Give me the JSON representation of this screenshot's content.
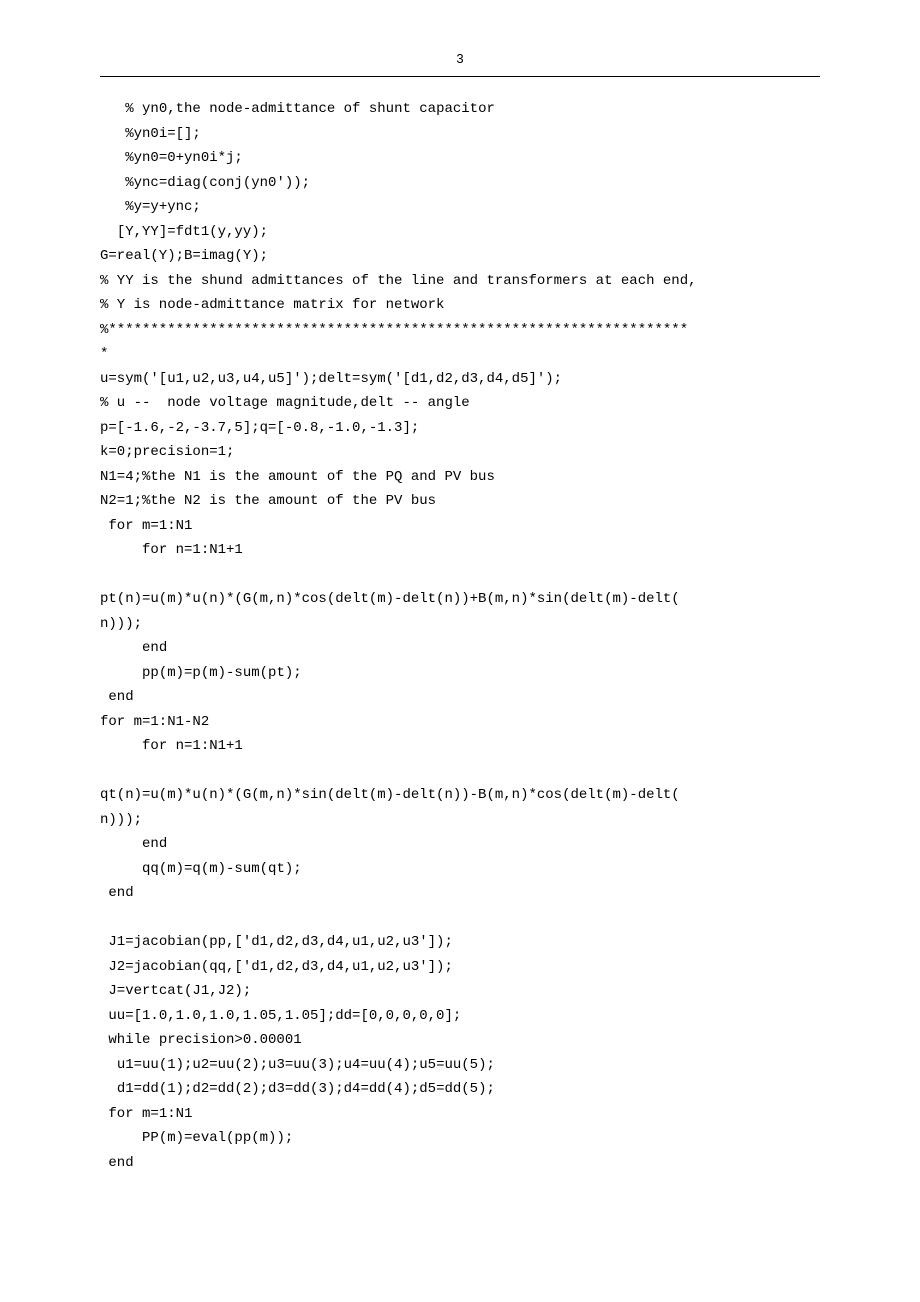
{
  "page_number": "3",
  "code_lines": [
    "   % yn0,the node-admittance of shunt capacitor",
    "   %yn0i=[];",
    "   %yn0=0+yn0i*j;",
    "   %ync=diag(conj(yn0'));",
    "   %y=y+ync;",
    "  [Y,YY]=fdt1(y,yy);",
    "G=real(Y);B=imag(Y);",
    "% YY is the shund admittances of the line and transformers at each end,",
    "% Y is node-admittance matrix for network",
    "%*********************************************************************",
    "*",
    "u=sym('[u1,u2,u3,u4,u5]');delt=sym('[d1,d2,d3,d4,d5]');",
    "% u --  node voltage magnitude,delt -- angle",
    "p=[-1.6,-2,-3.7,5];q=[-0.8,-1.0,-1.3];",
    "k=0;precision=1;",
    "N1=4;%the N1 is the amount of the PQ and PV bus",
    "N2=1;%the N2 is the amount of the PV bus",
    " for m=1:N1",
    "     for n=1:N1+1",
    "",
    "pt(n)=u(m)*u(n)*(G(m,n)*cos(delt(m)-delt(n))+B(m,n)*sin(delt(m)-delt(",
    "n)));",
    "     end",
    "     pp(m)=p(m)-sum(pt);",
    " end",
    "for m=1:N1-N2",
    "     for n=1:N1+1",
    "",
    "qt(n)=u(m)*u(n)*(G(m,n)*sin(delt(m)-delt(n))-B(m,n)*cos(delt(m)-delt(",
    "n)));",
    "     end",
    "     qq(m)=q(m)-sum(qt);",
    " end",
    "",
    " J1=jacobian(pp,['d1,d2,d3,d4,u1,u2,u3']);",
    " J2=jacobian(qq,['d1,d2,d3,d4,u1,u2,u3']);",
    " J=vertcat(J1,J2);",
    " uu=[1.0,1.0,1.0,1.05,1.05];dd=[0,0,0,0,0];",
    " while precision>0.00001",
    "  u1=uu(1);u2=uu(2);u3=uu(3);u4=uu(4);u5=uu(5);",
    "  d1=dd(1);d2=dd(2);d3=dd(3);d4=dd(4);d5=dd(5);",
    " for m=1:N1",
    "     PP(m)=eval(pp(m));",
    " end"
  ]
}
